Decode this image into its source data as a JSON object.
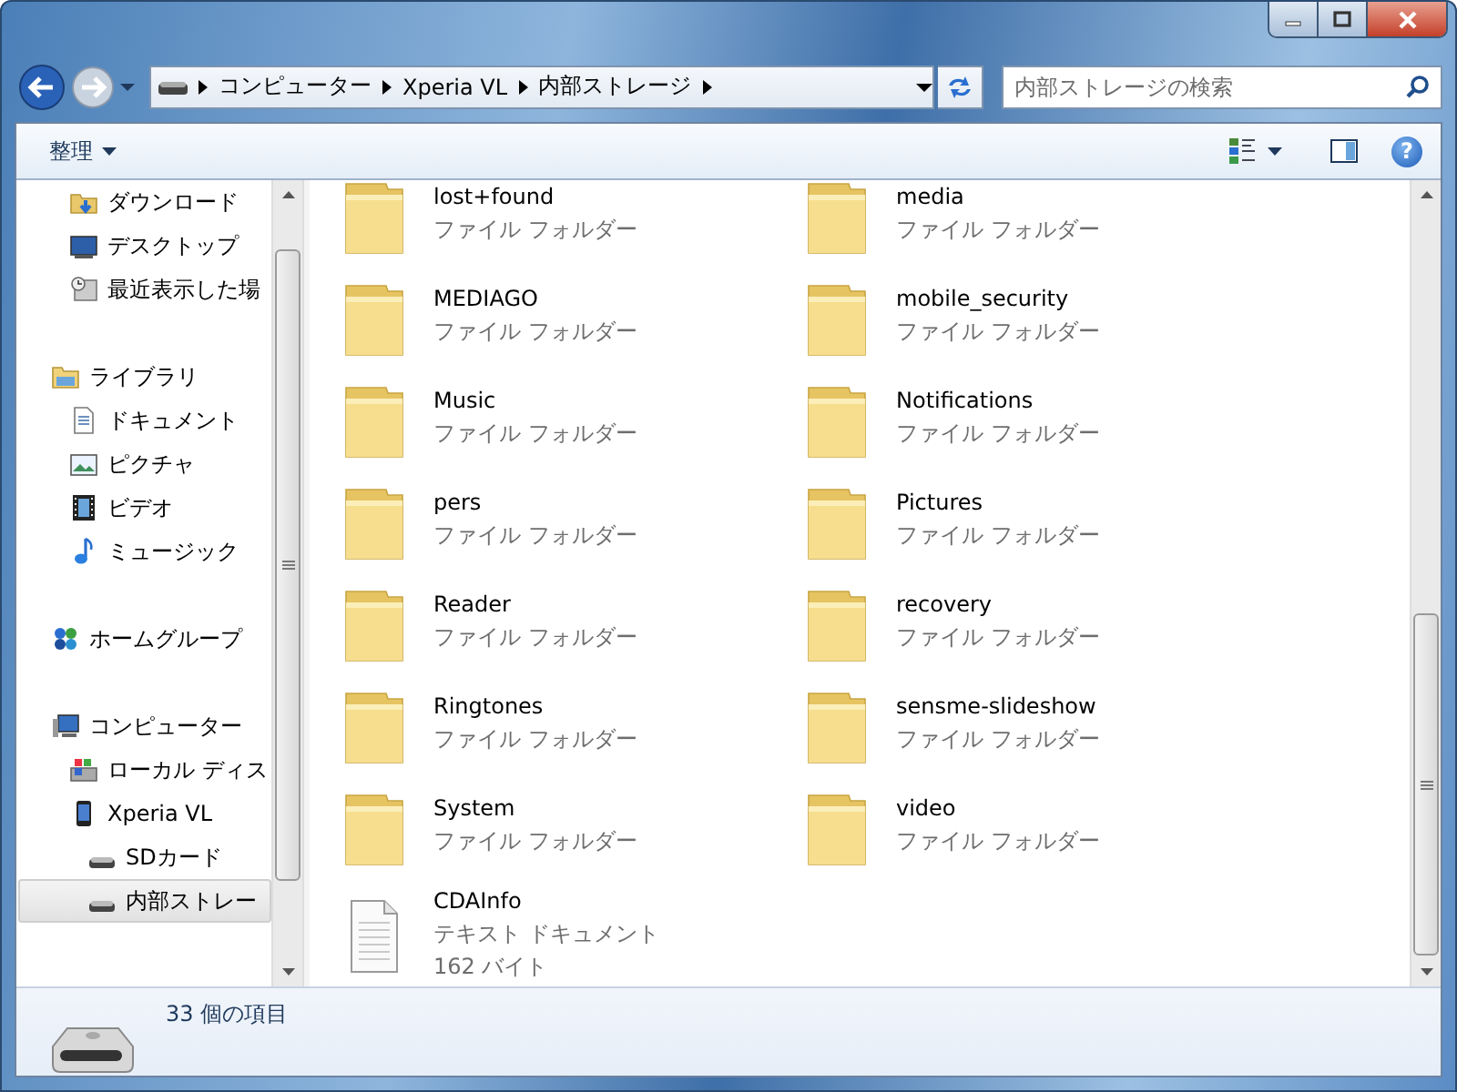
{
  "address": {
    "crumbs": [
      "コンピューター",
      "Xperia VL",
      "内部ストレージ"
    ]
  },
  "search": {
    "placeholder": "内部ストレージの検索"
  },
  "toolbar": {
    "organize": "整理",
    "help": "?"
  },
  "sidebar": {
    "items": [
      {
        "children": [
          {
            "kind": "download",
            "label": "ダウンロード",
            "selected": false
          },
          {
            "kind": "desktop",
            "label": "デスクトップ",
            "selected": false
          },
          {
            "kind": "recent",
            "label": "最近表示した場",
            "selected": false
          }
        ]
      },
      {
        "kind": "library",
        "label": "ライブラリ",
        "selected": false,
        "children": [
          {
            "kind": "document",
            "label": "ドキュメント",
            "selected": false
          },
          {
            "kind": "picture",
            "label": "ピクチャ",
            "selected": false
          },
          {
            "kind": "video",
            "label": "ビデオ",
            "selected": false
          },
          {
            "kind": "music",
            "label": "ミュージック",
            "selected": false
          }
        ]
      },
      {
        "kind": "homegroup",
        "label": "ホームグループ",
        "selected": false
      },
      {
        "kind": "computer",
        "label": "コンピューター",
        "selected": false,
        "children": [
          {
            "kind": "local-disk",
            "label": "ローカル ディス",
            "selected": false
          },
          {
            "kind": "phone",
            "label": "Xperia VL",
            "selected": false,
            "children": [
              {
                "kind": "drive",
                "label": "SDカード",
                "selected": false
              },
              {
                "kind": "drive",
                "label": "内部ストレー",
                "selected": true
              }
            ]
          }
        ]
      }
    ]
  },
  "files": [
    {
      "kind": "folder",
      "name": "lost+found",
      "type": "ファイル フォルダー"
    },
    {
      "kind": "folder",
      "name": "media",
      "type": "ファイル フォルダー"
    },
    {
      "kind": "folder",
      "name": "MEDIAGO",
      "type": "ファイル フォルダー"
    },
    {
      "kind": "folder",
      "name": "mobile_security",
      "type": "ファイル フォルダー"
    },
    {
      "kind": "folder",
      "name": "Music",
      "type": "ファイル フォルダー"
    },
    {
      "kind": "folder",
      "name": "Notifications",
      "type": "ファイル フォルダー"
    },
    {
      "kind": "folder",
      "name": "pers",
      "type": "ファイル フォルダー"
    },
    {
      "kind": "folder",
      "name": "Pictures",
      "type": "ファイル フォルダー"
    },
    {
      "kind": "folder",
      "name": "Reader",
      "type": "ファイル フォルダー"
    },
    {
      "kind": "folder",
      "name": "recovery",
      "type": "ファイル フォルダー"
    },
    {
      "kind": "folder",
      "name": "Ringtones",
      "type": "ファイル フォルダー"
    },
    {
      "kind": "folder",
      "name": "sensme-slideshow",
      "type": "ファイル フォルダー"
    },
    {
      "kind": "folder",
      "name": "System",
      "type": "ファイル フォルダー"
    },
    {
      "kind": "folder",
      "name": "video",
      "type": "ファイル フォルダー"
    },
    {
      "kind": "text",
      "name": "CDAInfo",
      "type": "テキスト ドキュメント",
      "size": "162 バイト"
    }
  ],
  "status_bar": {
    "text": "33 個の項目"
  }
}
